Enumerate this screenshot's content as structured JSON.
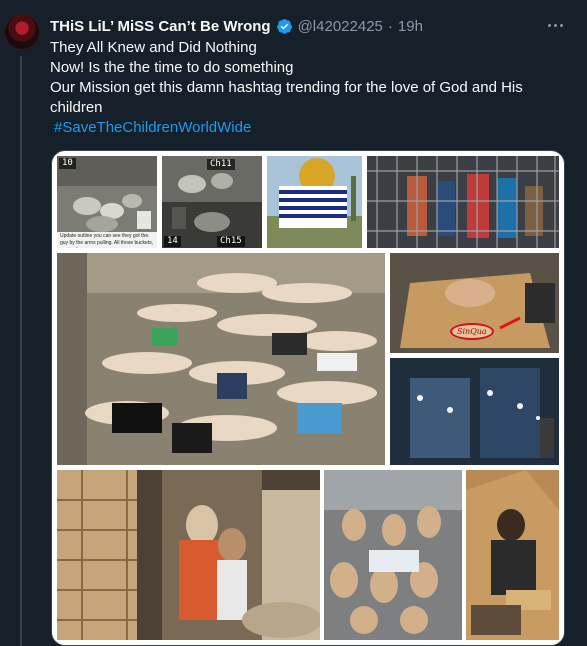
{
  "tweet": {
    "display_name": "THiS LiL’ MiSS Can’t Be Wrong",
    "handle": "@l42022425",
    "separator": "·",
    "time": "19h",
    "icons": {
      "verified": "verified-badge-icon",
      "more": "more-options-icon"
    },
    "lines": [
      "They All Knew and Did Nothing",
      "Now! Is the the time to do something",
      "Our Mission get this damn hashtag trending for the love of God and His",
      "children"
    ],
    "hashtag": "#SaveTheChildrenWorldWide"
  },
  "media": {
    "cctv_labels": {
      "top_left": "10",
      "top_mid": "Ch11",
      "bottom_left": "14",
      "bottom_mid": "Ch15"
    },
    "cctv_caption": "Update outline you can see they got the. guy by the arms pulling. All those buckets, a crimale area",
    "box_label": "SinQua"
  },
  "colors": {
    "background": "#15202b",
    "text": "#f7f9f9",
    "muted": "#8b98a5",
    "link": "#1d9bf0",
    "border": "#38444d"
  }
}
